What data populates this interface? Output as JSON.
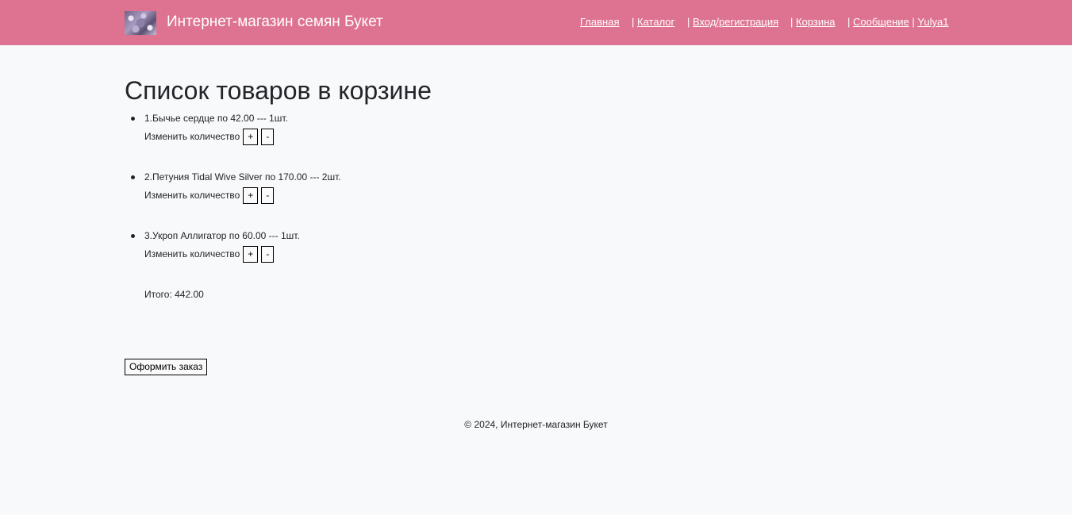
{
  "header": {
    "brand_title": "Интернет-магазин семян Букет",
    "nav": {
      "home": "Главная",
      "catalog": "Каталог",
      "login": "Вход/регистрация",
      "cart": "Корзина",
      "messages": "Сообщение",
      "user": "Yulya1",
      "separator": "|"
    },
    "accent_color": "#de7391"
  },
  "main": {
    "title": "Список товаров в корзине",
    "qty_label": "Изменить количество",
    "plus_label": "+",
    "minus_label": "-",
    "items": [
      {
        "text": "1.Бычье сердце по 42.00 --- 1шт."
      },
      {
        "text": "2.Петуния Tidal Wive Silver по 170.00 --- 2шт."
      },
      {
        "text": "3.Укроп Аллигатор по 60.00 --- 1шт."
      }
    ],
    "total_text": "Итого: 442.00",
    "checkout_label": "Оформить заказ"
  },
  "footer": {
    "text": "© 2024, Интернет-магазин Букет"
  }
}
